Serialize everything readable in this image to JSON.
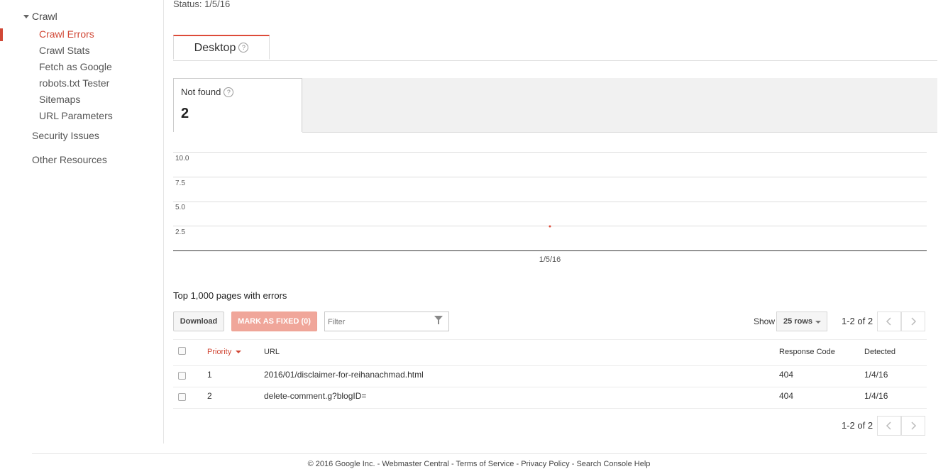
{
  "sidebar": {
    "crawl_label": "Crawl",
    "crawl_items": [
      {
        "label": "Crawl Errors",
        "active": true
      },
      {
        "label": "Crawl Stats"
      },
      {
        "label": "Fetch as Google"
      },
      {
        "label": "robots.txt Tester"
      },
      {
        "label": "Sitemaps"
      },
      {
        "label": "URL Parameters"
      }
    ],
    "security_label": "Security Issues",
    "other_label": "Other Resources"
  },
  "status_text": "Status: 1/5/16",
  "tabs": [
    {
      "label": "Desktop"
    }
  ],
  "help_glyph": "?",
  "metric": {
    "label": "Not found",
    "value": "2"
  },
  "chart_data": {
    "type": "scatter",
    "series": [
      {
        "x": [
          "1/5/16"
        ],
        "values": [
          2
        ]
      }
    ],
    "y_ticks": [
      "10.0",
      "7.5",
      "5.0",
      "2.5"
    ],
    "x_ticks": [
      "1/5/16"
    ],
    "ylim": [
      0,
      10
    ],
    "grid": true,
    "point_color": "#dd4b39"
  },
  "table": {
    "title": "Top 1,000 pages with errors",
    "download_label": "Download",
    "mark_fixed_label": "MARK AS FIXED (0)",
    "filter_placeholder": "Filter",
    "show_label": "Show",
    "rows_per_page": "25 rows",
    "pager_text": "1-2 of 2",
    "columns": {
      "priority": "Priority",
      "url": "URL",
      "response": "Response Code",
      "detected": "Detected"
    },
    "rows": [
      {
        "priority": "1",
        "url": "2016/01/disclaimer-for-reihanachmad.html",
        "response": "404",
        "detected": "1/4/16"
      },
      {
        "priority": "2",
        "url": "delete-comment.g?blogID=",
        "response": "404",
        "detected": "1/4/16"
      }
    ]
  },
  "footer": {
    "copyright": "© 2016 Google Inc.",
    "sep": "-",
    "links": [
      "Webmaster Central",
      "Terms of Service",
      "Privacy Policy",
      "Search Console Help"
    ]
  },
  "colors": {
    "accent": "#d14836",
    "mark_fixed_bg": "#f0a69a"
  }
}
